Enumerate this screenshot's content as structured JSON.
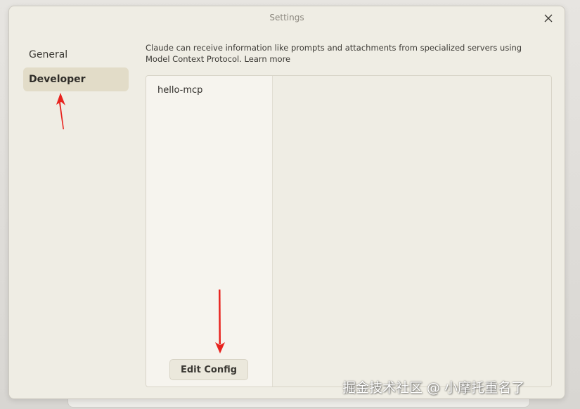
{
  "window": {
    "title": "Settings"
  },
  "sidebar": {
    "items": [
      {
        "label": "General",
        "active": false
      },
      {
        "label": "Developer",
        "active": true
      }
    ]
  },
  "developer": {
    "description": "Claude can receive information like prompts and attachments from specialized servers using Model Context Protocol.",
    "learn_more_label": "Learn more",
    "servers": [
      "hello-mcp"
    ],
    "edit_config_label": "Edit Config"
  },
  "watermark": {
    "text": "掘金技术社区 @ 小摩托重名了"
  },
  "colors": {
    "window_bg": "#efede4",
    "active_item_bg": "#e2dcc8",
    "server_list_bg": "#f6f4ee",
    "annotation_arrow": "#e8231e"
  },
  "icons": {
    "close": "close-icon"
  }
}
